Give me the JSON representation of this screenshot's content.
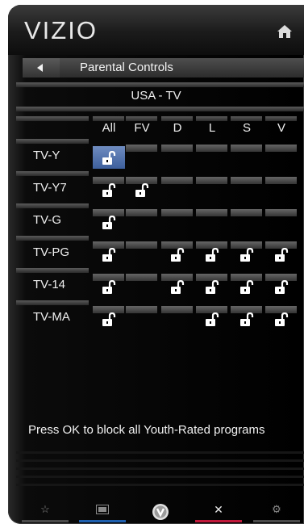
{
  "app": {
    "logo_text": "VIZIO",
    "home_icon": "home-icon"
  },
  "navigation": {
    "back_icon": "back-arrow-icon",
    "title": "Parental Controls"
  },
  "ratings": {
    "region": "USA - TV",
    "columns": [
      "All",
      "FV",
      "D",
      "L",
      "S",
      "V"
    ],
    "rows": [
      {
        "label": "TV-Y",
        "locks": [
          true,
          false,
          false,
          false,
          false,
          false
        ]
      },
      {
        "label": "TV-Y7",
        "locks": [
          true,
          true,
          false,
          false,
          false,
          false
        ]
      },
      {
        "label": "TV-G",
        "locks": [
          true,
          false,
          false,
          false,
          false,
          false
        ]
      },
      {
        "label": "TV-PG",
        "locks": [
          true,
          false,
          true,
          true,
          true,
          true
        ]
      },
      {
        "label": "TV-14",
        "locks": [
          true,
          false,
          true,
          true,
          true,
          true
        ]
      },
      {
        "label": "TV-MA",
        "locks": [
          true,
          false,
          false,
          true,
          true,
          true
        ]
      }
    ],
    "selected": {
      "row": "TV-Y",
      "column": "All"
    },
    "lock_icon": "unlocked-padlock-icon"
  },
  "help_text": "Press OK to block all Youth-Rated programs",
  "footer": {
    "items": [
      {
        "icon": "star-icon",
        "glyph": "☆",
        "accent": "#555555"
      },
      {
        "icon": "widget-icon",
        "glyph": "",
        "accent": "#1e5fae"
      },
      {
        "icon": "vizio-v-icon",
        "glyph": "V",
        "accent": "#000000"
      },
      {
        "icon": "close-icon",
        "glyph": "✕",
        "accent": "#c0183a"
      },
      {
        "icon": "gear-icon",
        "glyph": "⚙",
        "accent": "#555555"
      }
    ]
  },
  "colors": {
    "selection": "#5577b0",
    "background": "#000000",
    "text": "#f0f0f0"
  }
}
